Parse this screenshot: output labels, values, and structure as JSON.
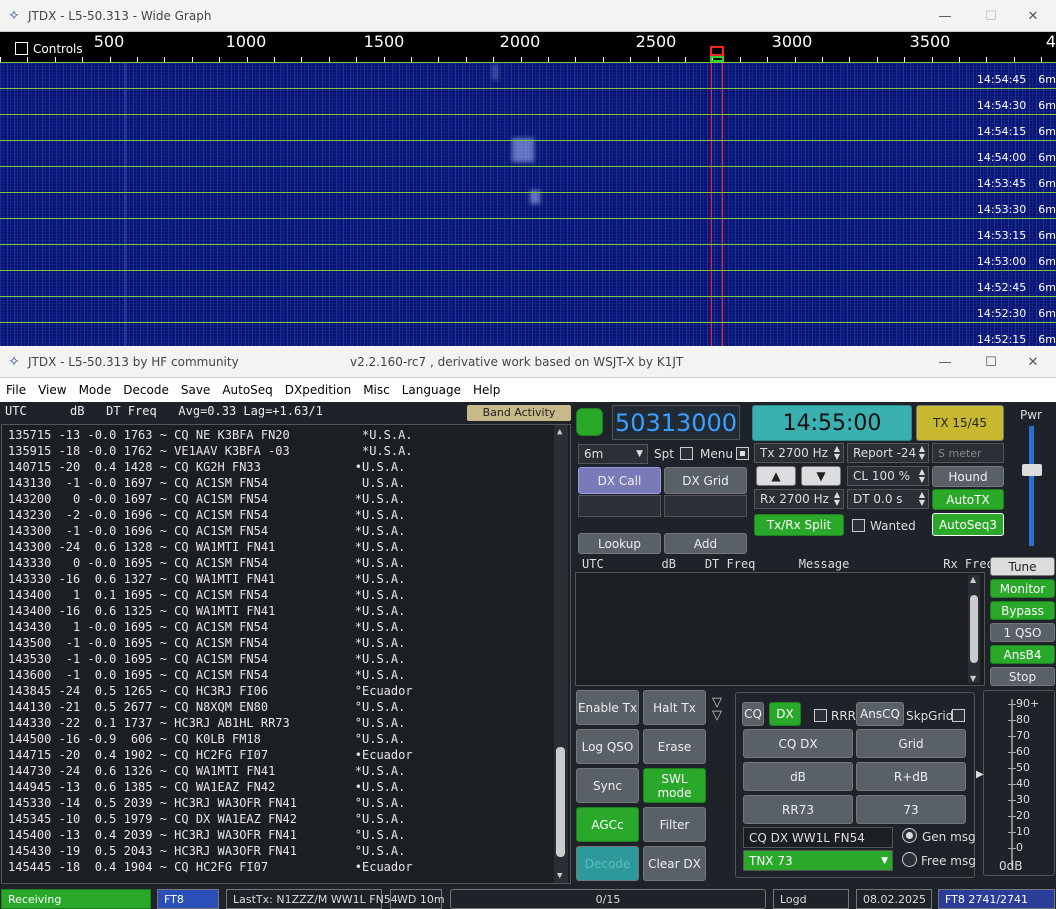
{
  "wide_graph": {
    "title": "JTDX - L5-50.313 - Wide Graph",
    "controls_label": "Controls",
    "ruler_labels": [
      "500",
      "1000",
      "1500",
      "2000",
      "2500",
      "3000",
      "3500",
      "4"
    ],
    "rows": [
      {
        "time": "14:54:45",
        "band": "6m"
      },
      {
        "time": "14:54:30",
        "band": "6m"
      },
      {
        "time": "14:54:15",
        "band": "6m"
      },
      {
        "time": "14:54:00",
        "band": "6m"
      },
      {
        "time": "14:53:45",
        "band": "6m"
      },
      {
        "time": "14:53:30",
        "band": "6m"
      },
      {
        "time": "14:53:15",
        "band": "6m"
      },
      {
        "time": "14:53:00",
        "band": "6m"
      },
      {
        "time": "14:52:45",
        "band": "6m"
      },
      {
        "time": "14:52:30",
        "band": "6m"
      },
      {
        "time": "14:52:15",
        "band": "6m"
      }
    ],
    "colors": {
      "marker": "#ff2020",
      "row_line": "#7cc73a"
    }
  },
  "main": {
    "title": "JTDX - L5-50.313   by HF community",
    "version": "v2.2.160-rc7 , derivative work based on WSJT-X by K1JT",
    "menu": [
      "File",
      "View",
      "Mode",
      "Decode",
      "Save",
      "AutoSeq",
      "DXpedition",
      "Misc",
      "Language",
      "Help"
    ],
    "left_header": "UTC      dB   DT Freq   Avg=0.33 Lag=+1.63/1",
    "band_activity": "Band Activity",
    "decodes": [
      "135715 -13 -0.0 1763 ~ CQ NE K3BFA FN20          *U.S.A.",
      "135915 -18 -0.0 1762 ~ VE1AAV K3BFA -03          *U.S.A.",
      "140715 -20  0.4 1428 ~ CQ KG2H FN33             •U.S.A.",
      "143130  -1 -0.0 1697 ~ CQ AC1SM FN54             U.S.A.",
      "143200   0 -0.0 1697 ~ CQ AC1SM FN54            *U.S.A.",
      "143230  -2 -0.0 1696 ~ CQ AC1SM FN54            *U.S.A.",
      "143300  -1 -0.0 1696 ~ CQ AC1SM FN54            *U.S.A.",
      "143300 -24  0.6 1328 ~ CQ WA1MTI FN41           *U.S.A.",
      "143330   0 -0.0 1695 ~ CQ AC1SM FN54            *U.S.A.",
      "143330 -16  0.6 1327 ~ CQ WA1MTI FN41           *U.S.A.",
      "143400   1  0.1 1695 ~ CQ AC1SM FN54            *U.S.A.",
      "143400 -16  0.6 1325 ~ CQ WA1MTI FN41           *U.S.A.",
      "143430   1 -0.0 1695 ~ CQ AC1SM FN54            *U.S.A.",
      "143500  -1 -0.0 1695 ~ CQ AC1SM FN54            *U.S.A.",
      "143530  -1 -0.0 1695 ~ CQ AC1SM FN54            *U.S.A.",
      "143600  -1  0.0 1695 ~ CQ AC1SM FN54            *U.S.A.",
      "143845 -24  0.5 1265 ~ CQ HC3RJ FI06            °Ecuador",
      "144130 -21  0.5 2677 ~ CQ N8XQM EN80            °U.S.A.",
      "144330 -22  0.1 1737 ~ HC3RJ AB1HL RR73         °U.S.A.",
      "144500 -16 -0.9  606 ~ CQ K0LB FM18             °U.S.A.",
      "144715 -20  0.4 1902 ~ CQ HC2FG FI07            •Ecuador",
      "144730 -24  0.6 1326 ~ CQ WA1MTI FN41           *U.S.A.",
      "144945 -13  0.6 1385 ~ CQ WA1EAZ FN42           •U.S.A.",
      "145330 -14  0.5 2039 ~ HC3RJ WA3OFR FN41        °U.S.A.",
      "145345 -10  0.5 1979 ~ CQ DX WA1EAZ FN42        °U.S.A.",
      "145400 -13  0.4 2039 ~ HC3RJ WA3OFR FN41        °U.S.A.",
      "145430 -19  0.5 2043 ~ HC3RJ WA3OFR FN41        °U.S.A.",
      "145445 -18  0.4 1904 ~ CQ HC2FG FI07            •Ecuador"
    ],
    "frequency": "50313000",
    "clock": "14:55:00",
    "tx_period": "TX 15/45",
    "pwr": "Pwr",
    "band": "6m",
    "spt": "Spt",
    "menu_lbl": "Menu",
    "dx_call": "DX Call",
    "dx_grid": "DX Grid",
    "tx_freq": "Tx  2700  Hz",
    "rx_freq": "Rx  2700  Hz",
    "report": "Report -24",
    "smeter": "S meter",
    "cl": "CL  100 %",
    "dt": "DT 0.0 s",
    "hound": "Hound",
    "autotx": "AutoTX",
    "autoseq": "AutoSeq3",
    "txrx_split": "Tx/Rx Split",
    "wanted": "Wanted",
    "lookup": "Lookup",
    "add": "Add",
    "right_header": "UTC        dB    DT Freq      Message             Rx Frequency",
    "side_buttons": [
      "Tune",
      "Monitor",
      "Bypass",
      "1 QSO",
      "AnsB4",
      "Stop"
    ],
    "grid_buttons": [
      "Enable Tx",
      "Halt Tx",
      "Log QSO",
      "Erase",
      "Sync",
      "SWL mode",
      "AGCc",
      "Filter",
      "Decode",
      "Clear DX"
    ],
    "cq": "CQ",
    "dx": "DX",
    "rrr": "RRR",
    "anscq": "AnsCQ",
    "skpgrid": "SkpGrid",
    "msg_buttons": [
      "CQ DX",
      "Grid",
      "dB",
      "R+dB",
      "RR73",
      "73"
    ],
    "tx_msg": "CQ DX WW1L FN54",
    "free_msg": "TNX 73",
    "gen_msg": "Gen msg",
    "free_msg_lbl": "Free msg",
    "meter_labels": [
      "90+",
      "80",
      "70",
      "60",
      "50",
      "40",
      "30",
      "20",
      "10",
      "0"
    ],
    "meter_unit": "0dB",
    "status": {
      "receiving": "Receiving",
      "mode": "FT8",
      "lasttx": "LastTx: N1ZZZ/M WW1L FN54",
      "wd": "WD 10m",
      "progress": "0/15",
      "logd": "Logd",
      "date": "08.02.2025",
      "ft8": "FT8  2741/2741"
    }
  }
}
